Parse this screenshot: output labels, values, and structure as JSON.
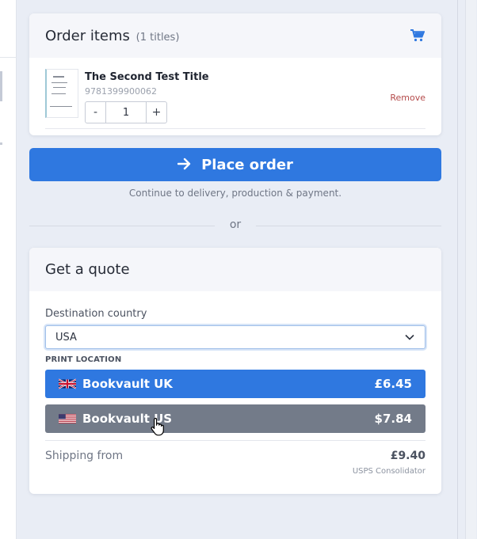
{
  "order": {
    "title": "Order items",
    "count": "(1 titles)",
    "icon": "cart-icon",
    "item": {
      "title": "The Second Test Title",
      "isbn": "9781399900062",
      "quantity": "1",
      "minus": "-",
      "plus": "+",
      "remove": "Remove"
    }
  },
  "place_order": {
    "label": "Place order",
    "note": "Continue to delivery, production & payment."
  },
  "divider_text": "or",
  "quote": {
    "title": "Get a quote",
    "destination_label": "Destination country",
    "destination_value": "USA",
    "print_location_label": "PRINT LOCATION",
    "locations": [
      {
        "name": "Bookvault UK",
        "price": "£6.45",
        "flag": "uk-flag-icon",
        "color": "#2f78e0"
      },
      {
        "name": "Bookvault US",
        "price": "$7.84",
        "flag": "us-flag-icon",
        "color": "#737b89"
      }
    ],
    "shipping_label": "Shipping from",
    "shipping_price": "£9.40",
    "shipping_carrier": "USPS Consolidator"
  },
  "colors": {
    "accent": "#2f78e0",
    "background": "#e9edf5",
    "remove": "#b44a4a"
  }
}
